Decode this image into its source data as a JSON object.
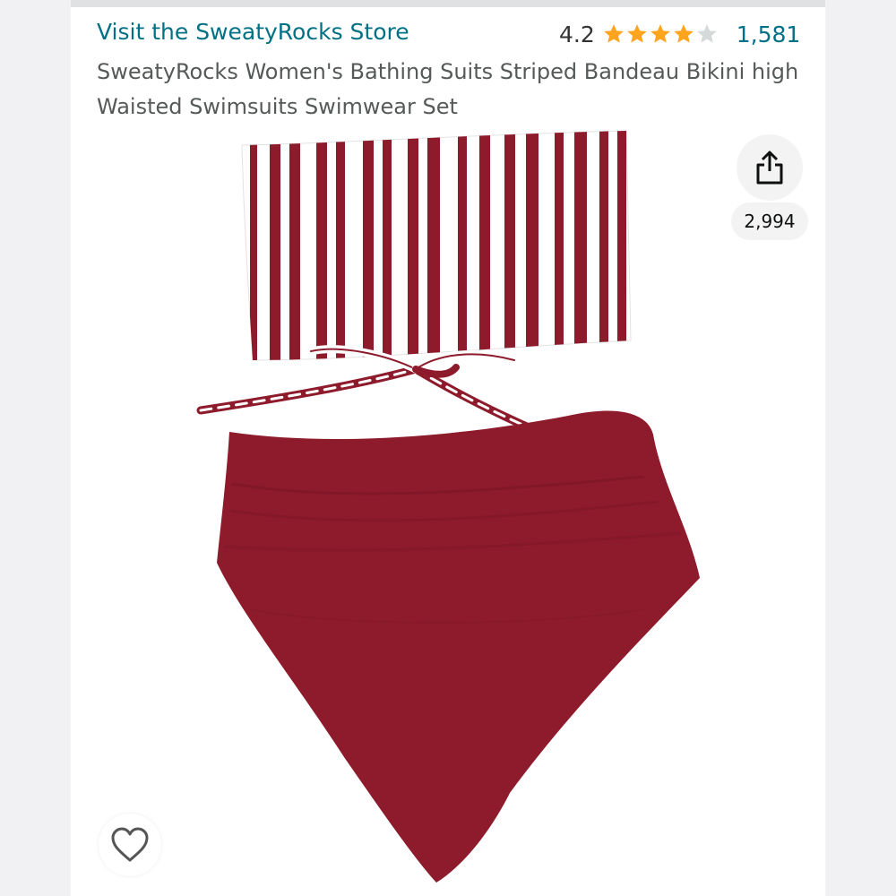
{
  "store": {
    "link_text": "Visit the SweatyRocks Store"
  },
  "rating": {
    "value": "4.2",
    "stars_filled": 4.2,
    "stars_max": 5,
    "count": "1,581"
  },
  "product": {
    "title": "SweatyRocks Women's Bathing Suits Striped Bandeau Bikini high Waisted Swimsuits Swimwear Set"
  },
  "actions": {
    "share_icon": "share-icon",
    "share_count": "2,994",
    "favorite_icon": "heart-icon"
  },
  "colors": {
    "link": "#007185",
    "title": "#565959",
    "star": "#FFA41C",
    "star_empty": "#D5D9D9",
    "swim_red": "#8E1B2C",
    "stripe_white": "#FFFFFF"
  }
}
